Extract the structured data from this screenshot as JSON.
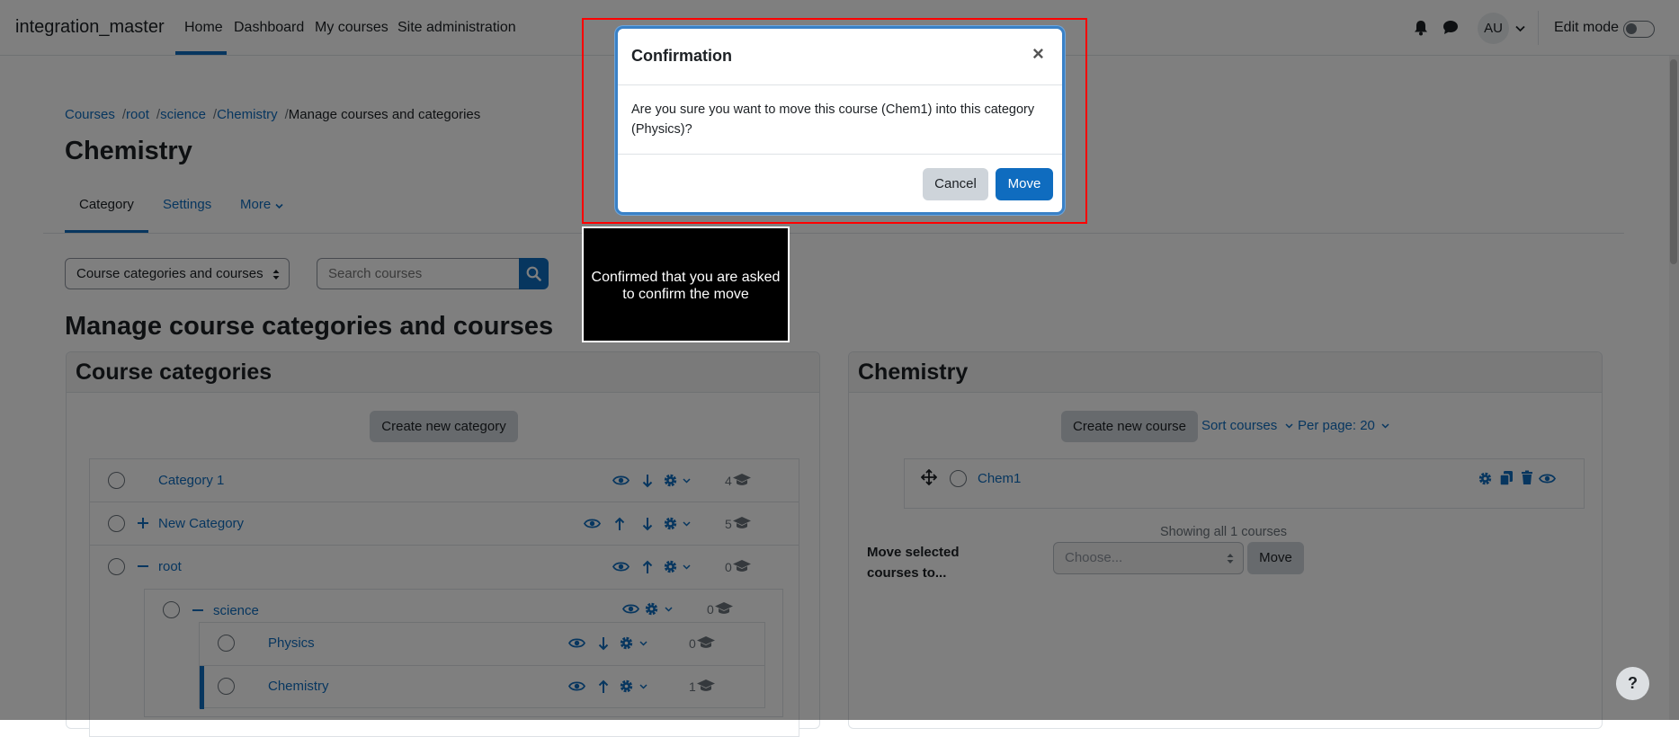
{
  "navbar": {
    "brand": "integration_master",
    "links": [
      "Home",
      "Dashboard",
      "My courses",
      "Site administration"
    ],
    "avatar_initials": "AU",
    "edit_mode_label": "Edit mode"
  },
  "breadcrumb": [
    "Courses",
    "root",
    "science",
    "Chemistry",
    "Manage courses and categories"
  ],
  "page_title": "Chemistry",
  "tabs": [
    "Category",
    "Settings",
    "More"
  ],
  "view_select": "Course categories and courses",
  "search": {
    "placeholder": "Search courses"
  },
  "manage_heading": "Manage course categories and courses",
  "categories_panel": {
    "title": "Course categories",
    "create_button": "Create new category",
    "rows": [
      {
        "label": "Category 1",
        "count": "4"
      },
      {
        "label": "New Category",
        "count": "5"
      },
      {
        "label": "root",
        "count": "0"
      },
      {
        "label": "science",
        "count": "0"
      },
      {
        "label": "Physics",
        "count": "0"
      },
      {
        "label": "Chemistry",
        "count": "1"
      }
    ]
  },
  "courses_panel": {
    "title": "Chemistry",
    "create_button": "Create new course",
    "sort_label": "Sort courses",
    "per_page_label": "Per page: 20",
    "course_name": "Chem1",
    "showing_text": "Showing all 1 courses",
    "move_selected_label": "Move selected courses to...",
    "choose_placeholder": "Choose...",
    "move_button": "Move"
  },
  "modal": {
    "title": "Confirmation",
    "close_symbol": "×",
    "body": "Are you sure you want to move this course (Chem1) into this category (Physics)?",
    "cancel": "Cancel",
    "move": "Move"
  },
  "annotation": {
    "tooltip": "Confirmed that you are asked to confirm the move",
    "highlight_color": "#ff0000"
  },
  "help_symbol": "?",
  "colors": {
    "primary": "#0f6cbf",
    "secondary": "#ced4da"
  }
}
